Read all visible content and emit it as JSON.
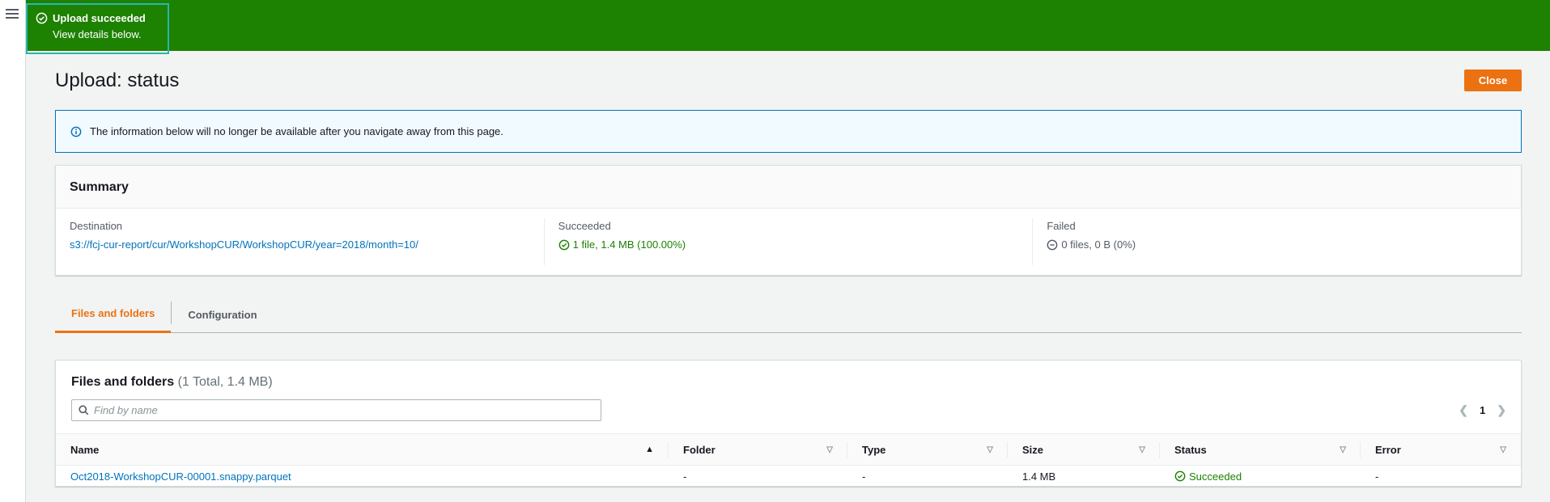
{
  "flash": {
    "title": "Upload succeeded",
    "subtitle": "View details below."
  },
  "page": {
    "title": "Upload: status",
    "close_label": "Close"
  },
  "info": {
    "message": "The information below will no longer be available after you navigate away from this page."
  },
  "summary": {
    "header": "Summary",
    "destination_label": "Destination",
    "destination_value": "s3://fcj-cur-report/cur/WorkshopCUR/WorkshopCUR/year=2018/month=10/",
    "succeeded_label": "Succeeded",
    "succeeded_value": "1 file, 1.4 MB (100.00%)",
    "failed_label": "Failed",
    "failed_value": "0 files, 0 B (0%)"
  },
  "tabs": [
    {
      "label": "Files and folders"
    },
    {
      "label": "Configuration"
    }
  ],
  "files": {
    "title": "Files and folders",
    "count": "(1 Total, 1.4 MB)",
    "search_placeholder": "Find by name",
    "page": "1",
    "columns": [
      "Name",
      "Folder",
      "Type",
      "Size",
      "Status",
      "Error"
    ],
    "rows": [
      {
        "name": "Oct2018-WorkshopCUR-00001.snappy.parquet",
        "folder": "-",
        "type": "-",
        "size": "1.4 MB",
        "status": "Succeeded",
        "error": "-"
      }
    ]
  },
  "colors": {
    "success_banner": "#1d8102",
    "accent": "#ec7211",
    "link": "#0073bb"
  }
}
